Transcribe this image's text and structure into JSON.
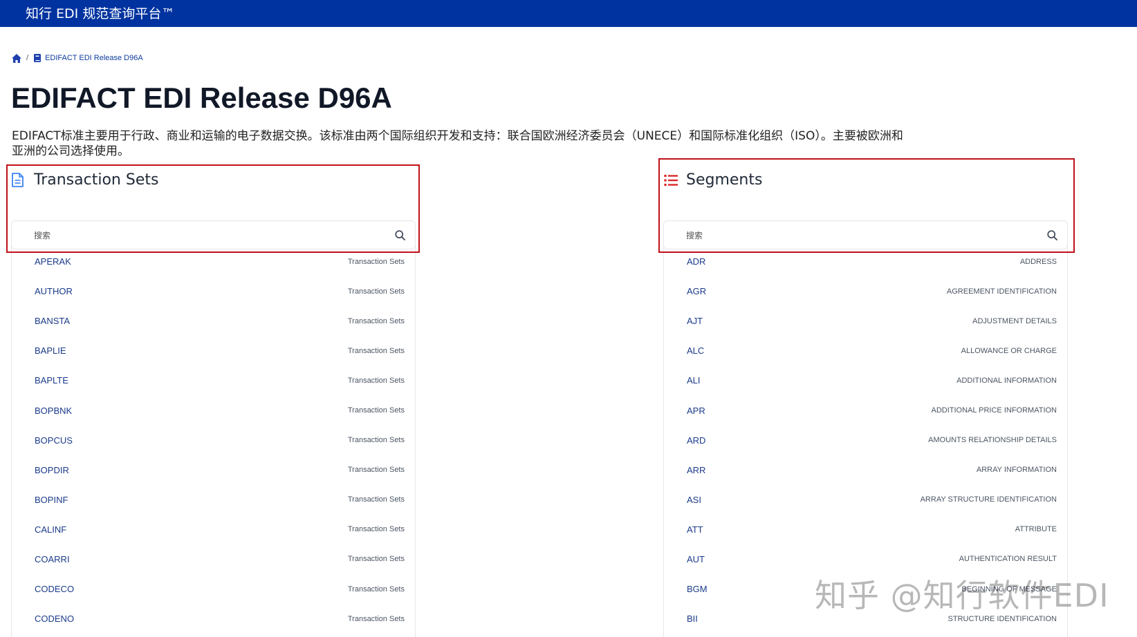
{
  "header": {
    "brand": "知行 EDI 规范查询平台™"
  },
  "breadcrumb": {
    "current": "EDIFACT EDI Release D96A",
    "separator": "/"
  },
  "page": {
    "title": "EDIFACT EDI Release D96A",
    "description": "EDIFACT标准主要用于行政、商业和运输的电子数据交换。该标准由两个国际组织开发和支持：联合国欧洲经济委员会（UNECE）和国际标准化组织（ISO）。主要被欧洲和亚洲的公司选择使用。"
  },
  "transaction_sets": {
    "title": "Transaction Sets",
    "search_placeholder": "搜索",
    "items": [
      {
        "code": "APERAK",
        "type": "Transaction Sets"
      },
      {
        "code": "AUTHOR",
        "type": "Transaction Sets"
      },
      {
        "code": "BANSTA",
        "type": "Transaction Sets"
      },
      {
        "code": "BAPLIE",
        "type": "Transaction Sets"
      },
      {
        "code": "BAPLTE",
        "type": "Transaction Sets"
      },
      {
        "code": "BOPBNK",
        "type": "Transaction Sets"
      },
      {
        "code": "BOPCUS",
        "type": "Transaction Sets"
      },
      {
        "code": "BOPDIR",
        "type": "Transaction Sets"
      },
      {
        "code": "BOPINF",
        "type": "Transaction Sets"
      },
      {
        "code": "CALINF",
        "type": "Transaction Sets"
      },
      {
        "code": "COARRI",
        "type": "Transaction Sets"
      },
      {
        "code": "CODECO",
        "type": "Transaction Sets"
      },
      {
        "code": "CODENO",
        "type": "Transaction Sets"
      }
    ]
  },
  "segments": {
    "title": "Segments",
    "search_placeholder": "搜索",
    "items": [
      {
        "code": "ADR",
        "name": "ADDRESS"
      },
      {
        "code": "AGR",
        "name": "AGREEMENT IDENTIFICATION"
      },
      {
        "code": "AJT",
        "name": "ADJUSTMENT DETAILS"
      },
      {
        "code": "ALC",
        "name": "ALLOWANCE OR CHARGE"
      },
      {
        "code": "ALI",
        "name": "ADDITIONAL INFORMATION"
      },
      {
        "code": "APR",
        "name": "ADDITIONAL PRICE INFORMATION"
      },
      {
        "code": "ARD",
        "name": "AMOUNTS RELATIONSHIP DETAILS"
      },
      {
        "code": "ARR",
        "name": "ARRAY INFORMATION"
      },
      {
        "code": "ASI",
        "name": "ARRAY STRUCTURE IDENTIFICATION"
      },
      {
        "code": "ATT",
        "name": "ATTRIBUTE"
      },
      {
        "code": "AUT",
        "name": "AUTHENTICATION RESULT"
      },
      {
        "code": "BGM",
        "name": "BEGINNING OF MESSAGE"
      },
      {
        "code": "BII",
        "name": "STRUCTURE IDENTIFICATION"
      }
    ]
  },
  "watermark": "知乎 @知行软件EDI",
  "colors": {
    "header_bg": "#0033a0",
    "highlight": "#c0101a",
    "link": "#1a3a8a"
  },
  "icons": [
    "home-icon",
    "book-icon",
    "document-icon",
    "list-icon",
    "search-icon"
  ]
}
